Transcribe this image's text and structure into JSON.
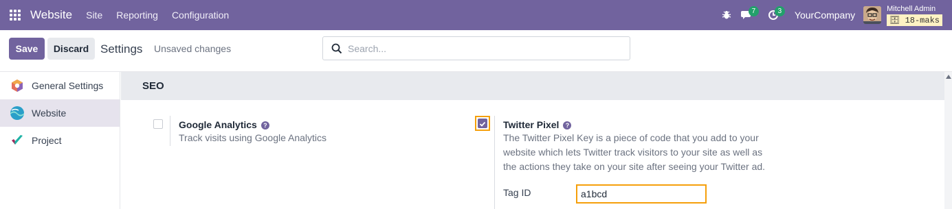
{
  "navbar": {
    "app_name": "Website",
    "menu": [
      "Site",
      "Reporting",
      "Configuration"
    ],
    "messages_count": "7",
    "activities_count": "3",
    "company": "YourCompany",
    "user_name": "Mitchell Admin",
    "database": "18-maks"
  },
  "control_panel": {
    "save_label": "Save",
    "discard_label": "Discard",
    "title": "Settings",
    "status": "Unsaved changes",
    "search_placeholder": "Search..."
  },
  "sidebar": {
    "items": [
      {
        "label": "General Settings",
        "icon": "odoo-settings-icon"
      },
      {
        "label": "Website",
        "icon": "website-app-icon",
        "active": true
      },
      {
        "label": "Project",
        "icon": "project-app-icon"
      }
    ]
  },
  "section": {
    "title": "SEO",
    "google_analytics": {
      "title": "Google Analytics",
      "description": "Track visits using Google Analytics",
      "checked": false
    },
    "twitter_pixel": {
      "title": "Twitter Pixel",
      "description_lines": [
        "The Twitter Pixel Key is a piece of code that you add to your",
        "website which lets Twitter track visitors to your site as well as",
        "the actions they take on your site after seeing your Twitter ad."
      ],
      "checked": true,
      "tag_label": "Tag ID",
      "tag_value": "a1bcd"
    }
  },
  "colors": {
    "brand": "#71639e",
    "highlight": "#f59f0a",
    "badge": "#22a06b"
  }
}
